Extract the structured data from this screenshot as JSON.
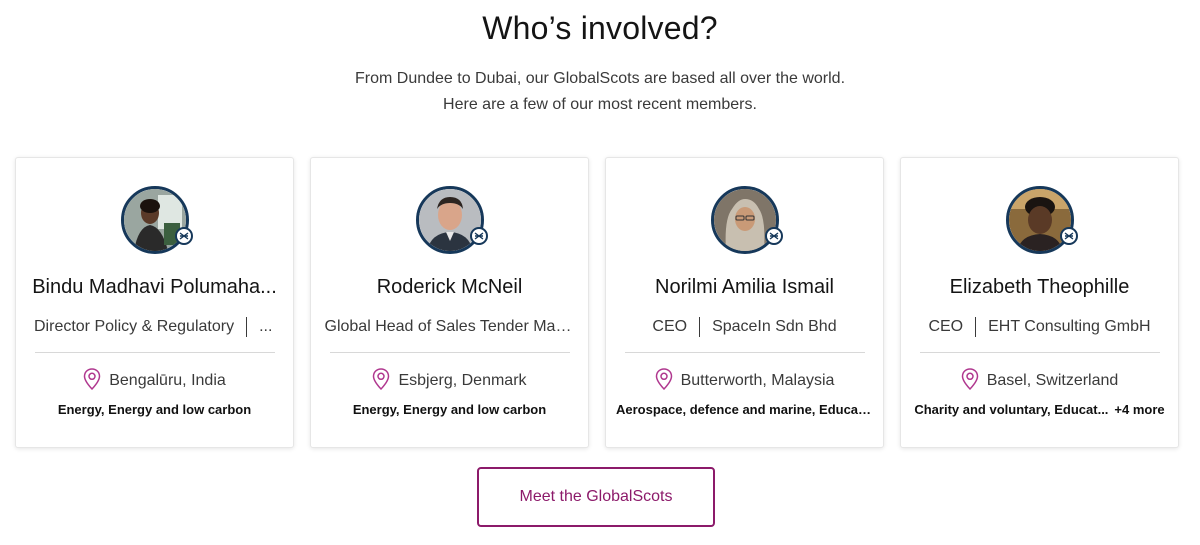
{
  "section": {
    "heading": "Who’s involved?",
    "subtitle_line1": "From Dundee to Dubai, our GlobalScots are based all over the world.",
    "subtitle_line2": "Here are a few of our most recent members."
  },
  "members": [
    {
      "name": "Bindu Madhavi Polumaha...",
      "title": "Director Policy & Regulatory",
      "organisation": "...",
      "location": "Bengalūru, India",
      "sectors": "Energy, Energy and low carbon",
      "more": ""
    },
    {
      "name": "Roderick McNeil",
      "title": "Global Head of Sales Tender Man...",
      "organisation": "",
      "location": "Esbjerg, Denmark",
      "sectors": "Energy, Energy and low carbon",
      "more": ""
    },
    {
      "name": "Norilmi Amilia Ismail",
      "title": "CEO",
      "organisation": "SpaceIn Sdn Bhd",
      "location": "Butterworth, Malaysia",
      "sectors": "Aerospace, defence and marine, Educat...",
      "more": ""
    },
    {
      "name": "Elizabeth Theophille",
      "title": "CEO",
      "organisation": "EHT Consulting GmbH",
      "location": "Basel, Switzerland",
      "sectors": "Charity and voluntary, Educat...",
      "more": "+4 more"
    }
  ],
  "cta": {
    "label": "Meet the GlobalScots"
  },
  "colors": {
    "accent": "#8c1a6a",
    "avatar_ring": "#16385a",
    "pin": "#b0388f"
  },
  "icons": {
    "location": "map-pin-icon",
    "badge": "globalscot-badge-icon"
  }
}
